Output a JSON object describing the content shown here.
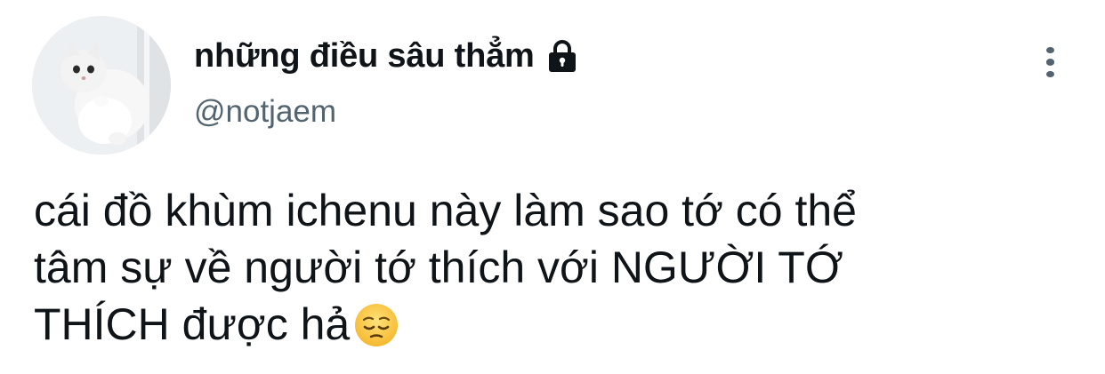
{
  "tweet": {
    "author": {
      "display_name": "những điều sâu thẳm",
      "handle": "@notjaem",
      "protected": true
    },
    "text": "cái đồ khùm ichenu này làm sao tớ có thể\ntâm sự về người tớ thích với NGƯỜI TỚ\nTHÍCH được hả",
    "trailing_emoji": "pensive-face-emoji"
  },
  "icons": {
    "lock": "lock-icon",
    "more": "more-vertical-icon"
  },
  "colors": {
    "text_primary": "#0f1419",
    "text_secondary": "#536471",
    "background": "#ffffff"
  }
}
